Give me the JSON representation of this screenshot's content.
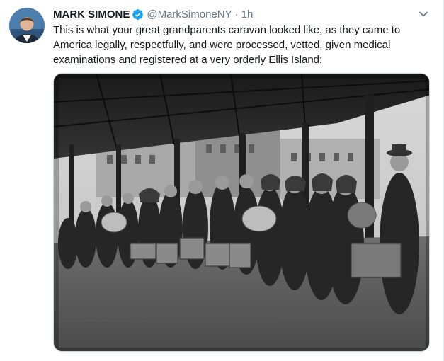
{
  "tweet": {
    "author_name": "MARK SIMONE",
    "author_handle": "@MarkSimoneNY",
    "separator": "·",
    "time": "1h",
    "text": "This is what your great grandparents caravan looked like, as they came to America legally, respectfully, and were processed, vetted, given medical examinations and registered at a very orderly Ellis Island:",
    "verified": true
  },
  "icons": {
    "verified": "verified-badge-icon",
    "menu": "chevron-down-icon"
  },
  "colors": {
    "verified_blue": "#1da1f2",
    "secondary_text": "#657786",
    "primary_text": "#14171a"
  }
}
